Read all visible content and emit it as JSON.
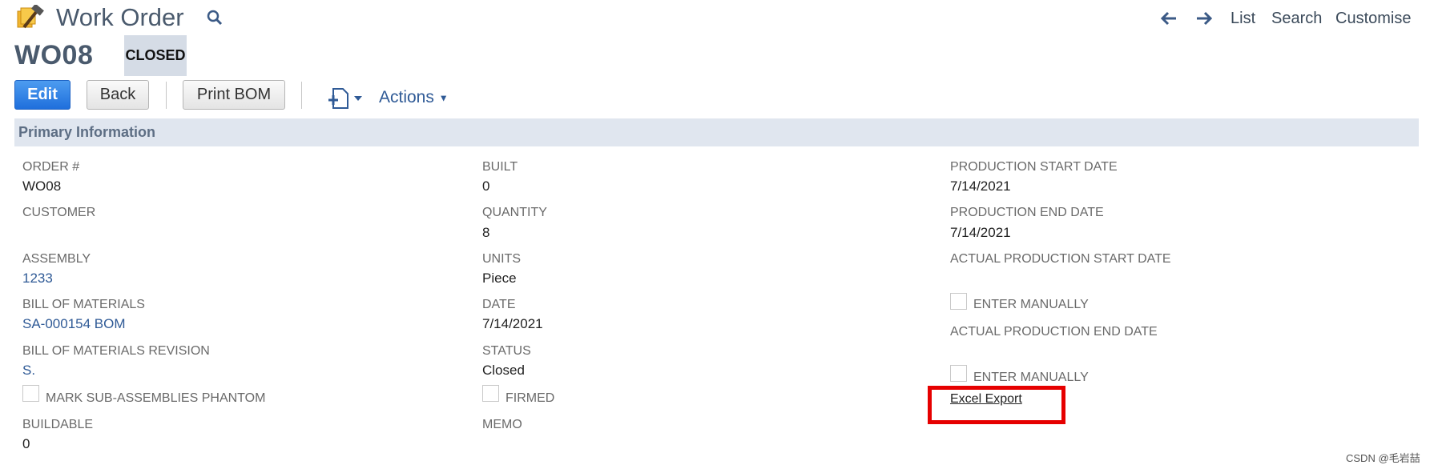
{
  "header": {
    "title": "Work Order",
    "title_icon": "hammer-icon",
    "search_icon": "search-icon",
    "nav": {
      "back_icon": "arrow-left-icon",
      "forward_icon": "arrow-right-icon",
      "list": "List",
      "search": "Search",
      "customise": "Customise"
    }
  },
  "record": {
    "id": "WO08",
    "status": "CLOSED"
  },
  "toolbar": {
    "edit": "Edit",
    "back": "Back",
    "print_bom": "Print BOM",
    "new_icon": "new-document-icon",
    "actions": "Actions"
  },
  "section": {
    "title": "Primary Information"
  },
  "fields": {
    "col1": {
      "order_label": "ORDER #",
      "order_value": "WO08",
      "customer_label": "CUSTOMER",
      "assembly_label": "ASSEMBLY",
      "assembly_value": "1233",
      "bom_label": "BILL OF MATERIALS",
      "bom_value": "SA-000154 BOM",
      "bom_rev_label": "BILL OF MATERIALS REVISION",
      "bom_rev_value": "S.",
      "phantom_label": "MARK SUB-ASSEMBLIES PHANTOM",
      "buildable_label": "BUILDABLE",
      "buildable_value": "0"
    },
    "col2": {
      "built_label": "BUILT",
      "built_value": "0",
      "quantity_label": "QUANTITY",
      "quantity_value": "8",
      "units_label": "UNITS",
      "units_value": "Piece",
      "date_label": "DATE",
      "date_value": "7/14/2021",
      "status_label": "STATUS",
      "status_value": "Closed",
      "firmed_label": "FIRMED",
      "memo_label": "MEMO"
    },
    "col3": {
      "prod_start_label": "PRODUCTION START DATE",
      "prod_start_value": "7/14/2021",
      "prod_end_label": "PRODUCTION END DATE",
      "prod_end_value": "7/14/2021",
      "actual_start_label": "ACTUAL PRODUCTION START DATE",
      "enter_manually_1": "ENTER MANUALLY",
      "actual_end_label": "ACTUAL PRODUCTION END DATE",
      "enter_manually_2": "ENTER MANUALLY",
      "excel_export": "Excel Export"
    }
  },
  "colors": {
    "accent": "#2f5a96",
    "highlight": "#e60000",
    "section_bg": "#e0e6ef"
  },
  "watermark": "CSDN @毛岩喆"
}
